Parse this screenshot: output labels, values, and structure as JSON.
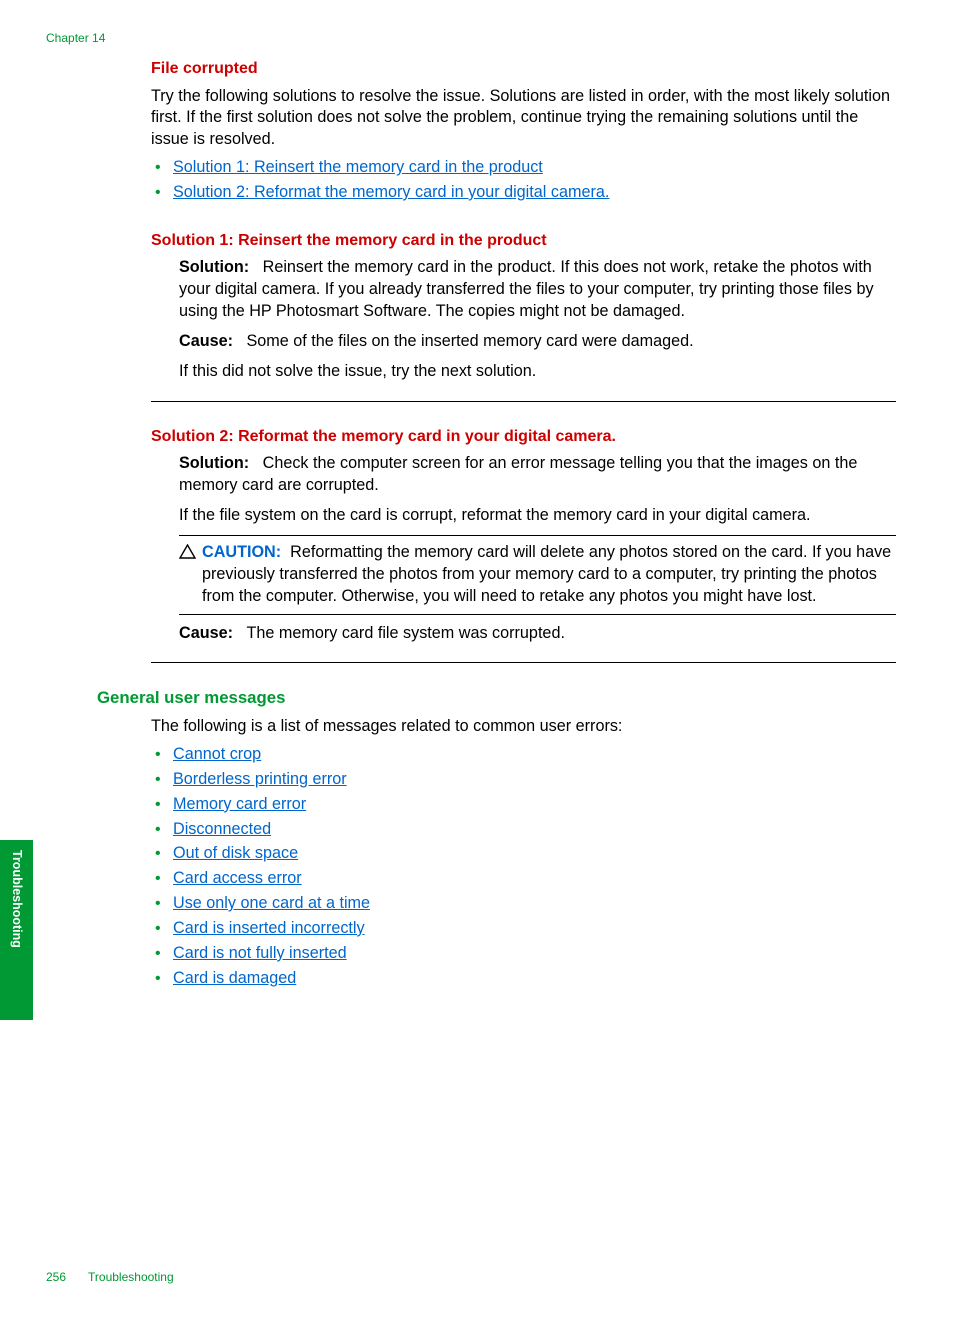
{
  "chapter_label": "Chapter 14",
  "side_tab": "Troubleshooting",
  "file_corrupted": {
    "heading": "File corrupted",
    "intro": "Try the following solutions to resolve the issue. Solutions are listed in order, with the most likely solution first. If the first solution does not solve the problem, continue trying the remaining solutions until the issue is resolved.",
    "links": [
      "Solution 1: Reinsert the memory card in the product",
      "Solution 2: Reformat the memory card in your digital camera."
    ]
  },
  "solution1": {
    "heading": "Solution 1: Reinsert the memory card in the product",
    "solution_label": "Solution:",
    "solution_text": "Reinsert the memory card in the product. If this does not work, retake the photos with your digital camera. If you already transferred the files to your computer, try printing those files by using the HP Photosmart Software. The copies might not be damaged.",
    "cause_label": "Cause:",
    "cause_text": "Some of the files on the inserted memory card were damaged.",
    "followup": "If this did not solve the issue, try the next solution."
  },
  "solution2": {
    "heading": "Solution 2: Reformat the memory card in your digital camera.",
    "solution_label": "Solution:",
    "solution_text": "Check the computer screen for an error message telling you that the images on the memory card are corrupted.",
    "extra": "If the file system on the card is corrupt, reformat the memory card in your digital camera.",
    "caution_label": "CAUTION:",
    "caution_text": "Reformatting the memory card will delete any photos stored on the card. If you have previously transferred the photos from your memory card to a computer, try printing the photos from the computer. Otherwise, you will need to retake any photos you might have lost.",
    "cause_label": "Cause:",
    "cause_text": "The memory card file system was corrupted."
  },
  "general": {
    "heading": "General user messages",
    "intro": "The following is a list of messages related to common user errors:",
    "links": [
      "Cannot crop",
      "Borderless printing error",
      "Memory card error",
      "Disconnected",
      "Out of disk space",
      "Card access error",
      "Use only one card at a time",
      "Card is inserted incorrectly",
      "Card is not fully inserted",
      "Card is damaged"
    ]
  },
  "footer": {
    "page": "256",
    "section": "Troubleshooting"
  }
}
